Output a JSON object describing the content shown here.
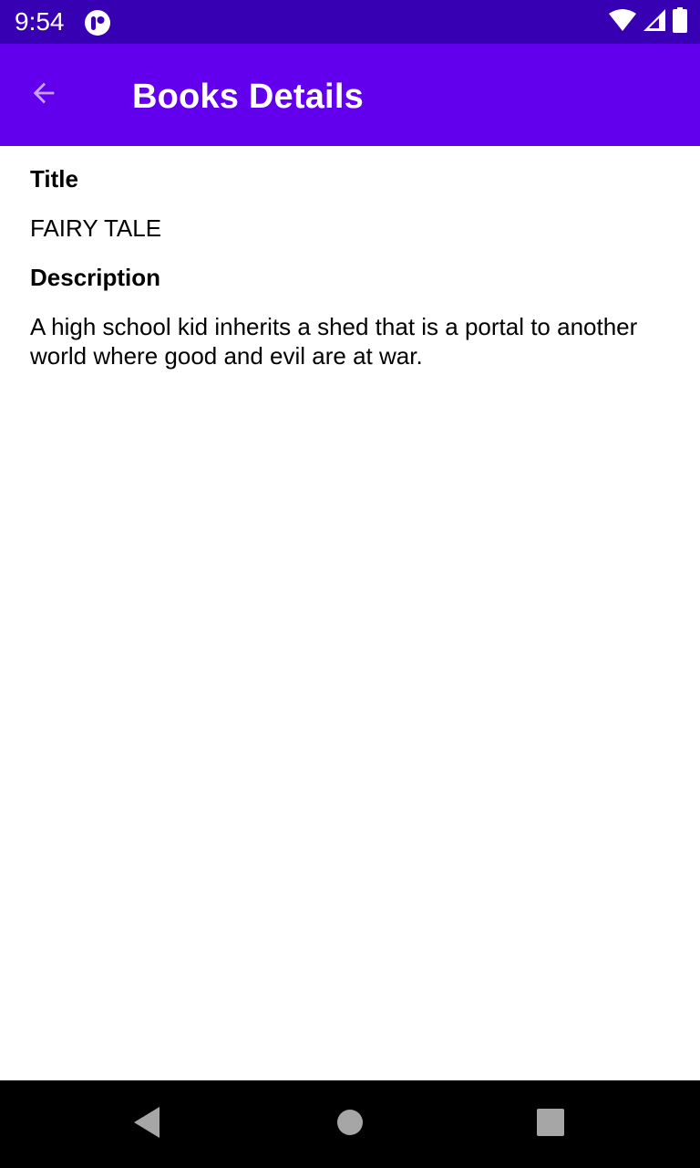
{
  "status_bar": {
    "time": "9:54",
    "background_color": "#3700b3",
    "icons": [
      "app-notification-icon",
      "wifi-icon",
      "cellular-signal-icon",
      "battery-icon"
    ]
  },
  "app_bar": {
    "title": "Books Details",
    "background_color": "#6200ee",
    "back_icon": "arrow-back-icon"
  },
  "book": {
    "title_label": "Title",
    "title_value": "FAIRY TALE",
    "description_label": "Description",
    "description_value": "A high school kid inherits a shed that is a portal to another world where good and evil are at war."
  },
  "nav_bar": {
    "buttons": [
      "back-triangle-icon",
      "home-circle-icon",
      "recents-square-icon"
    ]
  }
}
